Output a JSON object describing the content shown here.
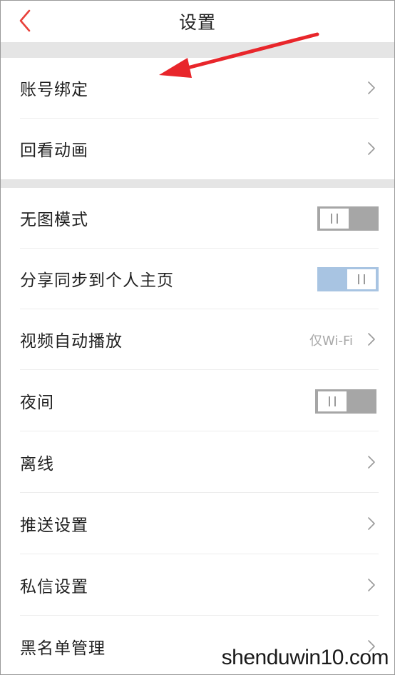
{
  "header": {
    "title": "设置",
    "back_icon": "chevron-left-icon",
    "accent_color": "#e8413a"
  },
  "groups": [
    {
      "items": [
        {
          "label": "账号绑定",
          "control": "chevron"
        },
        {
          "label": "回看动画",
          "control": "chevron"
        }
      ]
    },
    {
      "items": [
        {
          "label": "无图模式",
          "control": "toggle",
          "state": "off"
        },
        {
          "label": "分享同步到个人主页",
          "control": "toggle",
          "state": "on"
        },
        {
          "label": "视频自动播放",
          "control": "chevron",
          "value": "仅Wi-Fi"
        },
        {
          "label": "夜间",
          "control": "toggle",
          "state": "off"
        },
        {
          "label": "离线",
          "control": "chevron"
        },
        {
          "label": "推送设置",
          "control": "chevron"
        },
        {
          "label": "私信设置",
          "control": "chevron"
        },
        {
          "label": "黑名单管理",
          "control": "chevron"
        }
      ]
    }
  ],
  "annotation": {
    "arrow_color": "#e8262b"
  },
  "watermark": {
    "text": "shenduwin10.com"
  }
}
